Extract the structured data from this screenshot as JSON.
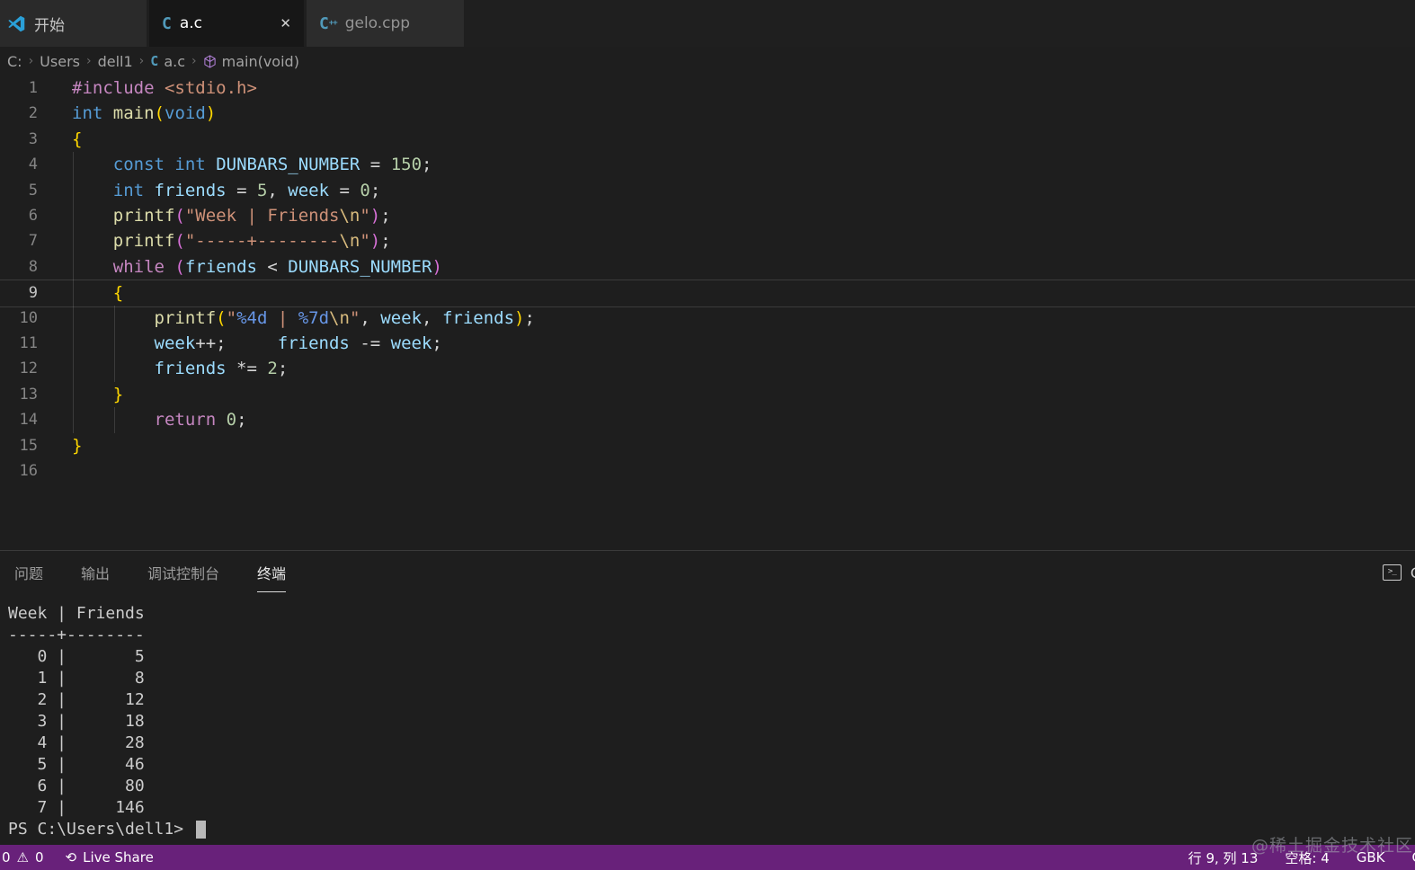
{
  "colors": {
    "status_bar": "#68217a",
    "editor_bg": "#1e1e1e",
    "keyword": "#569cd6",
    "control_keyword": "#c586c0",
    "function_name": "#dcdcaa",
    "variable": "#9cdcfe",
    "string": "#ce9178",
    "escape": "#d7ba7d",
    "format_specifier": "#6796e6",
    "number": "#b5cea8",
    "bracket_gold": "#ffd700",
    "bracket_pink": "#d670d6",
    "file_icon_blue": "#519aba",
    "symbol_cube_purple": "#b180d7"
  },
  "tab_bar": {
    "tabs": [
      {
        "label": "开始",
        "icon": "vscode-logo",
        "state": "inactive"
      },
      {
        "label": "a.c",
        "icon": "c-file",
        "state": "active",
        "close": "✕"
      },
      {
        "label": "gelo.cpp",
        "icon": "cpp-file",
        "state": "inactive"
      }
    ]
  },
  "breadcrumb": {
    "separator": "›",
    "items": [
      {
        "label": "C:",
        "icon": null
      },
      {
        "label": "Users",
        "icon": null
      },
      {
        "label": "dell1",
        "icon": null
      },
      {
        "label": "a.c",
        "icon": "c-file"
      },
      {
        "label": "main(void)",
        "icon": "symbol-method-cube"
      }
    ]
  },
  "editor": {
    "current_line": 9,
    "lines": [
      {
        "n": "1",
        "tokens": [
          {
            "t": "#include",
            "c": "ctrl"
          },
          {
            "t": " ",
            "c": "pun"
          },
          {
            "t": "<stdio.h>",
            "c": "str"
          }
        ]
      },
      {
        "n": "2",
        "tokens": [
          {
            "t": "int",
            "c": "kw"
          },
          {
            "t": " ",
            "c": "pun"
          },
          {
            "t": "main",
            "c": "fn"
          },
          {
            "t": "(",
            "c": "b1"
          },
          {
            "t": "void",
            "c": "kw"
          },
          {
            "t": ")",
            "c": "b1"
          }
        ]
      },
      {
        "n": "3",
        "tokens": [
          {
            "t": "{",
            "c": "b1"
          }
        ]
      },
      {
        "n": "4",
        "tokens": [
          {
            "t": "    ",
            "c": "pun"
          },
          {
            "t": "const",
            "c": "kw"
          },
          {
            "t": " ",
            "c": "pun"
          },
          {
            "t": "int",
            "c": "kw"
          },
          {
            "t": " ",
            "c": "pun"
          },
          {
            "t": "DUNBARS_NUMBER",
            "c": "var"
          },
          {
            "t": " = ",
            "c": "pun"
          },
          {
            "t": "150",
            "c": "num"
          },
          {
            "t": ";",
            "c": "pun"
          }
        ]
      },
      {
        "n": "5",
        "tokens": [
          {
            "t": "    ",
            "c": "pun"
          },
          {
            "t": "int",
            "c": "kw"
          },
          {
            "t": " ",
            "c": "pun"
          },
          {
            "t": "friends",
            "c": "var"
          },
          {
            "t": " = ",
            "c": "pun"
          },
          {
            "t": "5",
            "c": "num"
          },
          {
            "t": ", ",
            "c": "pun"
          },
          {
            "t": "week",
            "c": "var"
          },
          {
            "t": " = ",
            "c": "pun"
          },
          {
            "t": "0",
            "c": "num"
          },
          {
            "t": ";",
            "c": "pun"
          }
        ]
      },
      {
        "n": "6",
        "tokens": [
          {
            "t": "    ",
            "c": "pun"
          },
          {
            "t": "printf",
            "c": "fn"
          },
          {
            "t": "(",
            "c": "b2"
          },
          {
            "t": "\"Week | Friends",
            "c": "str"
          },
          {
            "t": "\\n",
            "c": "esc"
          },
          {
            "t": "\"",
            "c": "str"
          },
          {
            "t": ")",
            "c": "b2"
          },
          {
            "t": ";",
            "c": "pun"
          }
        ]
      },
      {
        "n": "7",
        "tokens": [
          {
            "t": "    ",
            "c": "pun"
          },
          {
            "t": "printf",
            "c": "fn"
          },
          {
            "t": "(",
            "c": "b2"
          },
          {
            "t": "\"-----+--------",
            "c": "str"
          },
          {
            "t": "\\n",
            "c": "esc"
          },
          {
            "t": "\"",
            "c": "str"
          },
          {
            "t": ")",
            "c": "b2"
          },
          {
            "t": ";",
            "c": "pun"
          }
        ]
      },
      {
        "n": "8",
        "tokens": [
          {
            "t": "    ",
            "c": "pun"
          },
          {
            "t": "while",
            "c": "ctrl"
          },
          {
            "t": " ",
            "c": "pun"
          },
          {
            "t": "(",
            "c": "b2"
          },
          {
            "t": "friends",
            "c": "var"
          },
          {
            "t": " < ",
            "c": "pun"
          },
          {
            "t": "DUNBARS_NUMBER",
            "c": "var"
          },
          {
            "t": ")",
            "c": "b2"
          }
        ]
      },
      {
        "n": "9",
        "tokens": [
          {
            "t": "    ",
            "c": "pun"
          },
          {
            "t": "{",
            "c": "b1"
          }
        ]
      },
      {
        "n": "10",
        "tokens": [
          {
            "t": "        ",
            "c": "pun"
          },
          {
            "t": "printf",
            "c": "fn"
          },
          {
            "t": "(",
            "c": "b1"
          },
          {
            "t": "\"",
            "c": "str"
          },
          {
            "t": "%4d",
            "c": "fmt"
          },
          {
            "t": " | ",
            "c": "str"
          },
          {
            "t": "%7d",
            "c": "fmt"
          },
          {
            "t": "\\n",
            "c": "esc"
          },
          {
            "t": "\"",
            "c": "str"
          },
          {
            "t": ", ",
            "c": "pun"
          },
          {
            "t": "week",
            "c": "var"
          },
          {
            "t": ", ",
            "c": "pun"
          },
          {
            "t": "friends",
            "c": "var"
          },
          {
            "t": ")",
            "c": "b1"
          },
          {
            "t": ";",
            "c": "pun"
          }
        ]
      },
      {
        "n": "11",
        "tokens": [
          {
            "t": "        ",
            "c": "pun"
          },
          {
            "t": "week",
            "c": "var"
          },
          {
            "t": "++;     ",
            "c": "pun"
          },
          {
            "t": "friends",
            "c": "var"
          },
          {
            "t": " -= ",
            "c": "pun"
          },
          {
            "t": "week",
            "c": "var"
          },
          {
            "t": ";",
            "c": "pun"
          }
        ]
      },
      {
        "n": "12",
        "tokens": [
          {
            "t": "        ",
            "c": "pun"
          },
          {
            "t": "friends",
            "c": "var"
          },
          {
            "t": " *= ",
            "c": "pun"
          },
          {
            "t": "2",
            "c": "num"
          },
          {
            "t": ";",
            "c": "pun"
          }
        ]
      },
      {
        "n": "13",
        "tokens": [
          {
            "t": "    ",
            "c": "pun"
          },
          {
            "t": "}",
            "c": "b1"
          }
        ]
      },
      {
        "n": "14",
        "tokens": [
          {
            "t": "        ",
            "c": "pun"
          },
          {
            "t": "return",
            "c": "ctrl"
          },
          {
            "t": " ",
            "c": "pun"
          },
          {
            "t": "0",
            "c": "num"
          },
          {
            "t": ";",
            "c": "pun"
          }
        ]
      },
      {
        "n": "15",
        "tokens": [
          {
            "t": "}",
            "c": "b1"
          }
        ]
      },
      {
        "n": "16",
        "tokens": []
      }
    ]
  },
  "panel": {
    "tabs": [
      {
        "label": "问题",
        "active": false
      },
      {
        "label": "输出",
        "active": false
      },
      {
        "label": "调试控制台",
        "active": false
      },
      {
        "label": "终端",
        "active": true
      }
    ],
    "corner": {
      "icon": "terminal-icon",
      "clipped_text": "C"
    }
  },
  "terminal": {
    "output_lines": [
      "Week | Friends",
      "-----+--------",
      "   0 |       5",
      "   1 |       8",
      "   2 |      12",
      "   3 |      18",
      "   4 |      28",
      "   5 |      46",
      "   6 |      80",
      "   7 |     146"
    ],
    "prompt": "PS C:\\Users\\dell1> "
  },
  "status_bar": {
    "errors": "0",
    "warning_icon": "⚠",
    "warnings": "0",
    "live_share": {
      "icon": "live-share-icon",
      "label": "Live Share"
    },
    "line_col": "行 9, 列 13",
    "indent": "空格: 4",
    "encoding": "GBK",
    "eol_clipped": "C"
  },
  "watermark": "@稀土掘金技术社区"
}
